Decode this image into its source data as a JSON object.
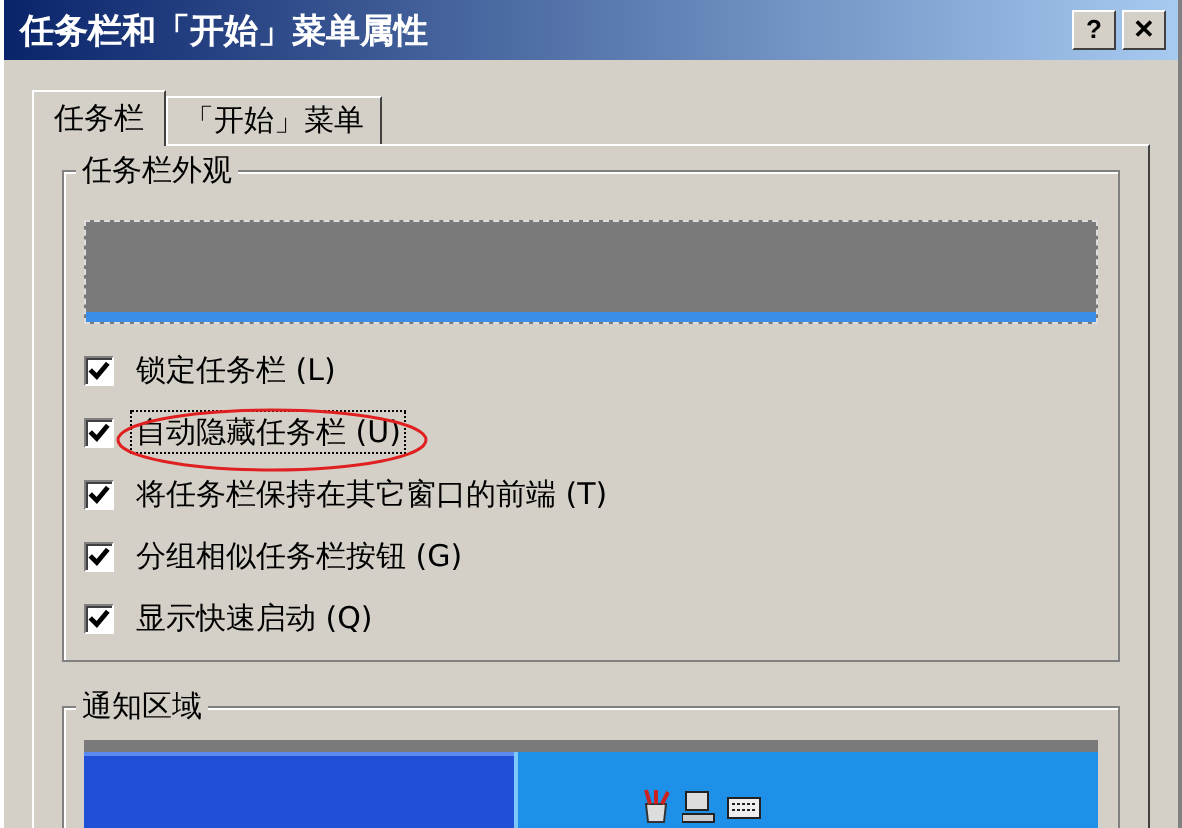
{
  "window": {
    "title": "任务栏和「开始」菜单属性",
    "help_button": "?",
    "close_button": "✕"
  },
  "tabs": [
    {
      "label": "任务栏",
      "selected": true
    },
    {
      "label": "「开始」菜单",
      "selected": false
    }
  ],
  "appearance_group": {
    "title": "任务栏外观",
    "options": [
      {
        "label": "锁定任务栏 (L)",
        "checked": true,
        "focused": false
      },
      {
        "label": "自动隐藏任务栏 (U)",
        "checked": true,
        "focused": true
      },
      {
        "label": "将任务栏保持在其它窗口的前端 (T)",
        "checked": true,
        "focused": false
      },
      {
        "label": "分组相似任务栏按钮 (G)",
        "checked": true,
        "focused": false
      },
      {
        "label": "显示快速启动 (Q)",
        "checked": true,
        "focused": false
      }
    ]
  },
  "notification_group": {
    "title": "通知区域"
  }
}
